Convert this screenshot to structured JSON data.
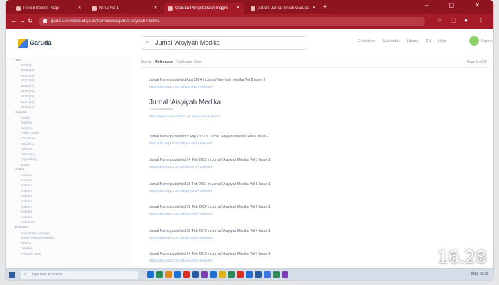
{
  "browser": {
    "tabs": [
      {
        "label": "Pencil Beliefs Page",
        "active": false
      },
      {
        "label": "Ninja No 1",
        "active": false
      },
      {
        "label": "Garuda Pengetahuan Inggris",
        "active": true
      },
      {
        "label": "Article Jurnal Ilmiah Garuda",
        "active": false
      }
    ],
    "url": "garuda.kemdikbud.go.id/journal/view/jurnal-asyiyah-medika",
    "window_controls": "–  ▢  ✕"
  },
  "site": {
    "logo_text": "Garuda",
    "search_query": "Jurnal 'Aisyiyah Medika",
    "header_links": [
      "Guidelines",
      "Subscribe",
      "Library",
      "EN",
      "Help"
    ],
    "header_end": "Sign in"
  },
  "sidebar": {
    "rows": [
      {
        "text": "Year",
        "head": true
      },
      {
        "text": "2024 (9)",
        "head": false
      },
      {
        "text": "2023 (18)",
        "head": false
      },
      {
        "text": "2022 (22)",
        "head": false
      },
      {
        "text": "2021 (30)",
        "head": false
      },
      {
        "text": "2020 (27)",
        "head": false
      },
      {
        "text": "2019 (25)",
        "head": false
      },
      {
        "text": "2018 (19)",
        "head": false
      },
      {
        "text": "2017 (16)",
        "head": false
      },
      {
        "text": "2016 (12)",
        "head": false
      },
      {
        "text": "Subject",
        "head": true
      },
      {
        "text": "Health",
        "head": false
      },
      {
        "text": "Nursing",
        "head": false
      },
      {
        "text": "Medicine",
        "head": false
      },
      {
        "text": "Public Health",
        "head": false
      },
      {
        "text": "Education",
        "head": false
      },
      {
        "text": "Midwifery",
        "head": false
      },
      {
        "text": "Nutrition",
        "head": false
      },
      {
        "text": "Pharmacy",
        "head": false
      },
      {
        "text": "Psychology",
        "head": false
      },
      {
        "text": "Social",
        "head": false
      },
      {
        "text": "Author",
        "head": true
      },
      {
        "text": "Author 1",
        "head": false
      },
      {
        "text": "Author 2",
        "head": false
      },
      {
        "text": "Author 3",
        "head": false
      },
      {
        "text": "Author 4",
        "head": false
      },
      {
        "text": "Author 5",
        "head": false
      },
      {
        "text": "Author 6",
        "head": false
      },
      {
        "text": "Author 7",
        "head": false
      },
      {
        "text": "Author 8",
        "head": false
      },
      {
        "text": "Author 9",
        "head": false
      },
      {
        "text": "Author 10",
        "head": false
      },
      {
        "text": "Publisher",
        "head": true
      },
      {
        "text": "Universitas 'Aisyiyah",
        "head": false
      },
      {
        "text": "Jurnal 'Aisyiyah Medika",
        "head": false
      },
      {
        "text": "STIKes",
        "head": false
      },
      {
        "text": "Fakultas",
        "head": false
      },
      {
        "text": "Program Studi",
        "head": false
      }
    ]
  },
  "main": {
    "filter_prefix": "Sort by",
    "filter_active": "Relevance",
    "filter_rest": "Publication Date",
    "filter_right": "Page 1 of 30",
    "featured": {
      "title": "Jurnal 'Aisyiyah Medika",
      "meta": "Jurnal Publisher",
      "links": "https://garuda.kemdikbud.go.id/journal  •  Indexed"
    },
    "results": [
      {
        "line": "Jurnal Name published Aug 2024 in Jurnal 'Aisyiyah Medika  Vol 9 Issue 2",
        "links": "https://doi.org/10.36729/jam.v9i2  •  Indexed"
      },
      {
        "line": "Jurnal Name published 5 Aug 2023 in Jurnal 'Aisyiyah Medika  Vol 8 Issue 2",
        "links": "https://doi.org/10.36729/jam.v8i2  •  Indexed"
      },
      {
        "line": "Jurnal Name published 14 Feb 2022 in Jurnal 'Aisyiyah Medika  Vol 7 Issue 1",
        "links": "https://doi.org/10.36729/jam.v7i1  •  Indexed"
      },
      {
        "line": "Jurnal Name published 28 Feb 2021 in Jurnal 'Aisyiyah Medika  Vol 6 Issue 1",
        "links": "https://doi.org/10.36729/jam.v6i1  •  Indexed"
      },
      {
        "line": "Jurnal Name published 12 Feb 2020 in Jurnal 'Aisyiyah Medika  Vol 5 Issue 1",
        "links": "https://doi.org/10.36729/jam.v5i1  •  Indexed"
      },
      {
        "line": "Jurnal Name published 18 Feb 2019 in Jurnal 'Aisyiyah Medika  Vol 4 Issue 1",
        "links": "https://doi.org/10.36729/jam.v4i1  •  Indexed"
      },
      {
        "line": "Jurnal Name published 14 Feb 2018 in Jurnal 'Aisyiyah Medika  Vol 3 Issue 1",
        "links": "https://doi.org/10.36729/jam.v3i1  •  Indexed"
      }
    ]
  },
  "taskbar": {
    "search_placeholder": "Type here to search",
    "tray": "ENG  16:28",
    "icon_colors": [
      "#1d6fd1",
      "#2e8b57",
      "#e08a1e",
      "#1d6fd1",
      "#d93025",
      "#2c5aa0",
      "#7b3fb0",
      "#1d6fd1",
      "#e0b21e",
      "#2e8b57",
      "#d93025",
      "#1d6fd1",
      "#2c5aa0",
      "#3d7ae0",
      "#2e8b57",
      "#7b3fb0"
    ]
  },
  "overlay": {
    "timestamp": "16.28"
  }
}
